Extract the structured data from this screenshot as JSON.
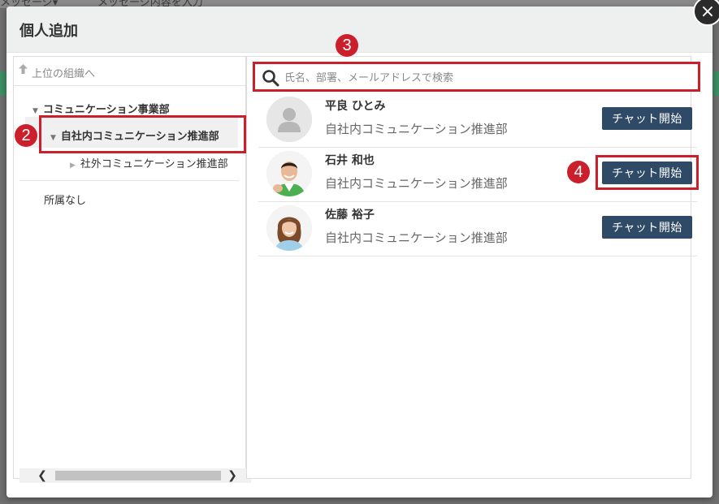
{
  "backdrop": {
    "top_left_text": "メッセージ▾",
    "top_center_text": "メッセージ内容を入力"
  },
  "modal": {
    "title": "個人追加",
    "close_glyph": "×"
  },
  "tree": {
    "up_link": "上位の組織へ",
    "items": [
      {
        "label": "コミュニケーション事業部",
        "expanded": true
      },
      {
        "label": "自社内コミュニケーション推進部",
        "expanded": true,
        "selected": true
      },
      {
        "label": "社外コミュニケーション推進部",
        "expanded": false
      }
    ],
    "unassigned": "所属なし"
  },
  "search": {
    "placeholder": "氏名、部署、メールアドレスで検索",
    "value": ""
  },
  "people": [
    {
      "name": "平良 ひとみ",
      "dept": "自社内コミュニケーション推進部",
      "button": "チャット開始",
      "avatar": "default-avatar"
    },
    {
      "name": "石井 和也",
      "dept": "自社内コミュニケーション推進部",
      "button": "チャット開始",
      "avatar": "photo-man"
    },
    {
      "name": "佐藤 裕子",
      "dept": "自社内コミュニケーション推進部",
      "button": "チャット開始",
      "avatar": "photo-woman"
    }
  ],
  "annotations": {
    "badge2": "2",
    "badge3": "3",
    "badge4": "4"
  },
  "colors": {
    "accent_red": "#cc1f2c",
    "button_navy": "#2f4a66"
  }
}
